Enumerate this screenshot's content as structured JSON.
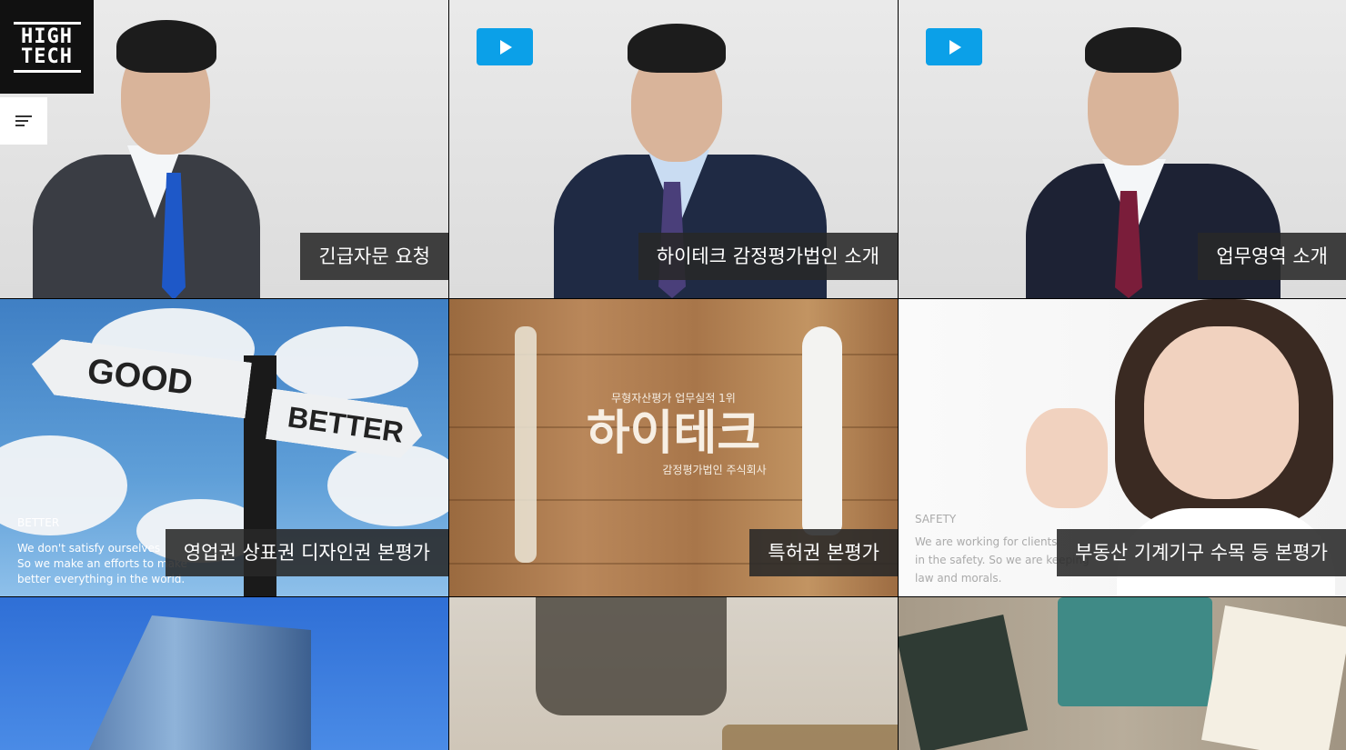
{
  "logo": {
    "line1": "HIGH",
    "line2": "TECH"
  },
  "tiles": [
    {
      "caption": "긴급자문 요청"
    },
    {
      "caption": "하이테크 감정평가법인 소개"
    },
    {
      "caption": "업무영역 소개"
    },
    {
      "caption": "영업권 상표권 디자인권 본평가",
      "overlay_title": "BETTER",
      "overlay_text": [
        "We don't satisfy ourselves",
        "So we make an efforts to make",
        "better everything in the world."
      ],
      "sign_left": "GOOD",
      "sign_right": "BETTER"
    },
    {
      "caption": "특허권 본평가",
      "overlay_top": "무형자산평가 업무실적 1위",
      "overlay_brand": "하이테크",
      "overlay_sub": "감정평가법인 주식회사"
    },
    {
      "caption": "부동산 기계기구 수목 등 본평가",
      "overlay_title": "SAFETY",
      "overlay_text": [
        "We are working for clients",
        "in the safety.  So we are keeping",
        "law and morals."
      ]
    },
    {
      "caption": ""
    },
    {
      "caption": ""
    },
    {
      "caption": ""
    }
  ],
  "colors": {
    "play": "#0ba0e8",
    "caption_bg": "#282828"
  }
}
